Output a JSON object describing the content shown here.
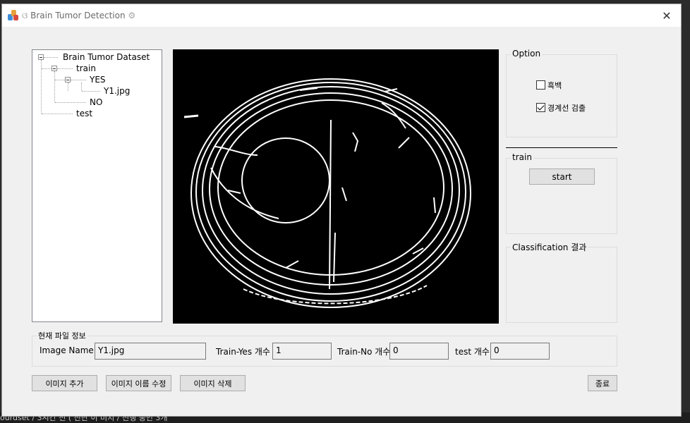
{
  "window": {
    "title": "Brain Tumor Detection",
    "close_glyph": "✕"
  },
  "tree": {
    "root": "Brain Tumor Dataset",
    "train": "train",
    "yes": "YES",
    "file": "Y1.jpg",
    "no": "NO",
    "test": "test"
  },
  "option": {
    "title": "Option",
    "grayscale_label": "흑백",
    "grayscale_checked": false,
    "edge_label": "경계선 검출",
    "edge_checked": true
  },
  "train_group": {
    "title": "train",
    "start_label": "start"
  },
  "classification": {
    "title": "Classification 결과"
  },
  "file_info": {
    "title": "현재 파일 정보",
    "image_name_label": "Image Name",
    "image_name_value": "Y1.jpg",
    "train_yes_label": "Train-Yes 개수",
    "train_yes_value": "1",
    "train_no_label": "Train-No 개수",
    "train_no_value": "0",
    "test_label": "test 개수",
    "test_value": "0"
  },
  "buttons": {
    "add_image": "이미지 추가",
    "rename_image": "이미지 이름 수정",
    "delete_image": "이미지 삭제",
    "exit": "종료"
  },
  "background_text": "ourdset / 3시간 전 ( 진단 이 미지 / 진행 중인 3개"
}
